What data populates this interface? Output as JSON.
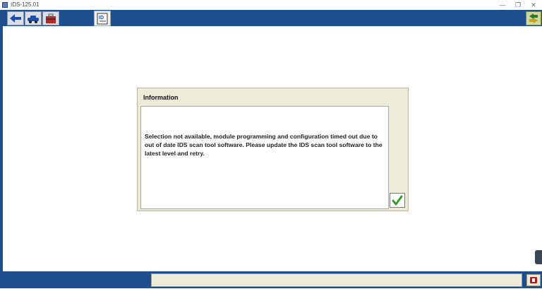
{
  "window": {
    "title": "IDS-125.01",
    "minimize_icon": "minimize-icon",
    "restore_icon": "restore-icon",
    "close_icon": "close-icon"
  },
  "toolbar": {
    "buttons": [
      {
        "icon": "back-arrow-icon"
      },
      {
        "icon": "vehicle-icon"
      },
      {
        "icon": "toolbox-icon"
      }
    ],
    "active_tab_icon": "ids-info-icon",
    "right_button_icon": "swap-arrows-icon"
  },
  "dialog": {
    "title": "Information",
    "message": "Selection not available, module programming and configuration timed out due to out of date IDS scan tool software. Please update the IDS scan tool software to the latest level and retry.",
    "ok_icon": "checkmark-icon"
  },
  "statusbar": {
    "text": "",
    "icon": "vmm-device-icon"
  },
  "colors": {
    "toolbar_blue": "#1e4e8c",
    "dialog_bg": "#ecebd8",
    "ok_green": "#3c9a2c"
  }
}
